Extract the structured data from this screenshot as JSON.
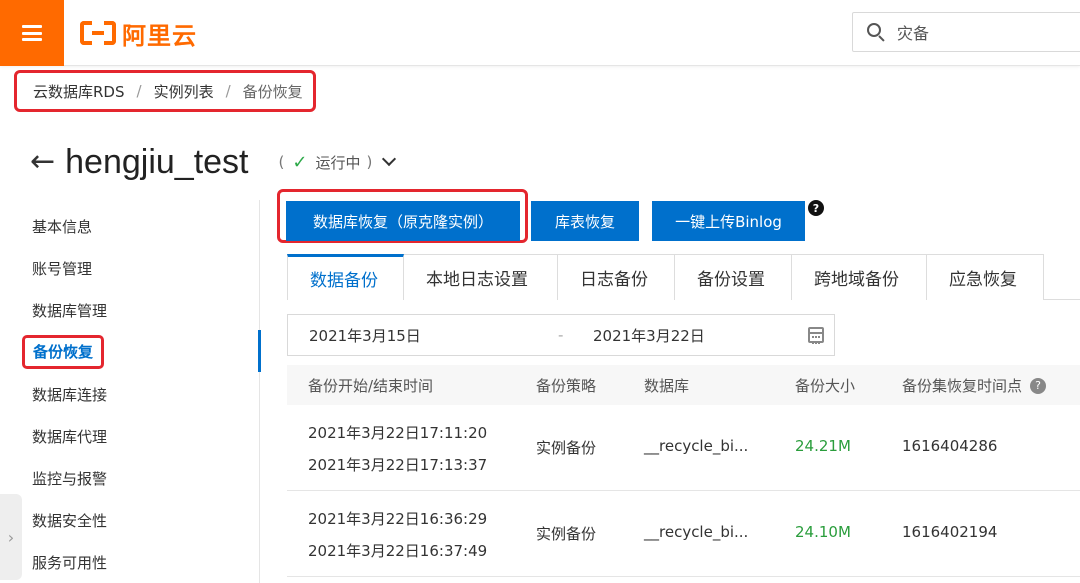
{
  "header": {
    "logo_text": "阿里云",
    "search_value": "灾备"
  },
  "breadcrumb": {
    "items": [
      "云数据库RDS",
      "实例列表",
      "备份恢复"
    ],
    "separator": "/"
  },
  "instance": {
    "back_glyph": "←",
    "name": "hengjiu_test",
    "status_open": "(",
    "status": "运行中",
    "status_close": ")"
  },
  "sidebar": {
    "items": [
      {
        "label": "基本信息"
      },
      {
        "label": "账号管理"
      },
      {
        "label": "数据库管理"
      },
      {
        "label": "备份恢复"
      },
      {
        "label": "数据库连接"
      },
      {
        "label": "数据库代理"
      },
      {
        "label": "监控与报警"
      },
      {
        "label": "数据安全性"
      },
      {
        "label": "服务可用性"
      }
    ],
    "active_index": 3
  },
  "actions": {
    "db_restore": "数据库恢复（原克隆实例）",
    "table_restore": "库表恢复",
    "upload_binlog": "一键上传Binlog",
    "help": "?"
  },
  "tabs": [
    "数据备份",
    "本地日志设置",
    "日志备份",
    "备份设置",
    "跨地域备份",
    "应急恢复"
  ],
  "date_range": {
    "start": "2021年3月15日",
    "separator": "-",
    "end": "2021年3月22日"
  },
  "table": {
    "columns": [
      "备份开始/结束时间",
      "备份策略",
      "数据库",
      "备份大小",
      "备份集恢复时间点"
    ],
    "help": "?",
    "rows": [
      {
        "start": "2021年3月22日17:11:20",
        "end": "2021年3月22日17:13:37",
        "policy": "实例备份",
        "database": "__recycle_bi...",
        "size": "24.21M",
        "restore_point": "1616404286"
      },
      {
        "start": "2021年3月22日16:36:29",
        "end": "2021年3月22日16:37:49",
        "policy": "实例备份",
        "database": "__recycle_bi...",
        "size": "24.10M",
        "restore_point": "1616402194"
      }
    ]
  },
  "colors": {
    "brand": "#ff6a00",
    "primary": "#0070cc",
    "highlight": "#e4262e",
    "success": "#2eaa4a"
  }
}
